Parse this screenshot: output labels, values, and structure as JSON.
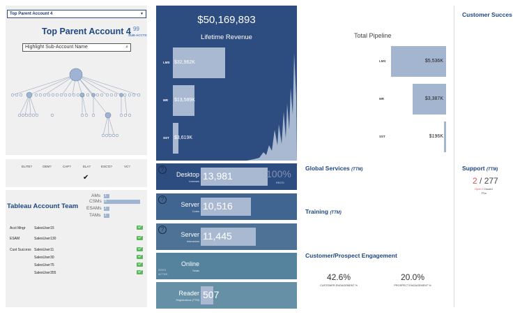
{
  "account": {
    "selector_value": "Top Parent Account 4",
    "title": "Top Parent Account 4",
    "subaccts_count": "99",
    "subaccts_label": "SUB-ACCTS",
    "search_placeholder": "Highlight Sub-Account Name"
  },
  "flags": {
    "labels": [
      "ELITE?",
      "OEM?",
      "CAP?",
      "ELA?",
      "ESC'D?",
      "VC?"
    ],
    "checked_index": 3,
    "check_glyph": "✔"
  },
  "team": {
    "title": "Tableau Account Team",
    "role_counts": [
      {
        "label": "AMs",
        "count": "1",
        "fraction": 0.12
      },
      {
        "label": "CSMs",
        "count": "6",
        "fraction": 1.0
      },
      {
        "label": "ESAMs",
        "count": "1",
        "fraction": 0.12
      },
      {
        "label": "TAMs",
        "count": "1",
        "fraction": 0.12
      }
    ],
    "members": [
      {
        "role": "Acct Mngr",
        "user": "SalesUser15"
      },
      {
        "role": "ESAM",
        "user": "SalesUser130"
      },
      {
        "role": "Cust Success",
        "user": "SalesUser11"
      },
      {
        "role": "",
        "user": "SalesUser30"
      },
      {
        "role": "",
        "user": "SalesUser75"
      },
      {
        "role": "",
        "user": "SalesUser355"
      }
    ]
  },
  "revenue": {
    "value": "$50,169,893",
    "label": "Lifetime Revenue",
    "bars": [
      {
        "cat": "LMS",
        "value": 32962,
        "text": "$32,962K"
      },
      {
        "cat": "MR",
        "value": 13589,
        "text": "$13,589K"
      },
      {
        "cat": "SST",
        "value": 3619,
        "text": "$3,619K"
      }
    ]
  },
  "kpis": [
    {
      "name": "Desktop",
      "sub": "Licenses",
      "value": "13,981",
      "fraction": 1.0,
      "extra": "100%",
      "extra_sub": "REG'D",
      "bg": "#2d4c7f"
    },
    {
      "name": "Server",
      "sub": "Cores",
      "value": "10,516",
      "fraction": 0.75,
      "extra": "",
      "extra_sub": "",
      "bg": "#3f6590"
    },
    {
      "name": "Server",
      "sub": "Interactors",
      "value": "11,445",
      "fraction": 0.82,
      "extra": "",
      "extra_sub": "",
      "bg": "#4d7296"
    },
    {
      "name": "Online",
      "sub": "Seats",
      "value": "",
      "fraction": 0,
      "extra": "",
      "extra_sub": "",
      "bg": "#55829d",
      "side": "SITES\nACTIVE"
    },
    {
      "name": "Reader",
      "sub": "Registrations (TTM)",
      "value": "507",
      "fraction": 0.12,
      "extra": "",
      "extra_sub": "",
      "bg": "#6690a5"
    }
  ],
  "pipeline": {
    "title": "Total Pipeline",
    "bars": [
      {
        "cat": "LMS",
        "value": 5536,
        "text": "$5,536K"
      },
      {
        "cat": "MR",
        "value": 3387,
        "text": "$3,387K"
      },
      {
        "cat": "SST",
        "value": 196,
        "text": "$196K"
      }
    ]
  },
  "sections": {
    "global_services": "Global Services",
    "global_services_suffix": "(TTM)",
    "training": "Training",
    "training_suffix": "(TTM)",
    "engagement": "Customer/Prospect Engagement",
    "customer_success": "Customer Succes",
    "support": "Support",
    "support_suffix": "(TTM)"
  },
  "engagement": {
    "customer_pct": "42.6%",
    "customer_label": "CUSTOMER ENGAGEMENT %",
    "prospect_pct": "20.0%",
    "prospect_label": "PROSPECT ENGAGEMENT %"
  },
  "support": {
    "open": "2",
    "sep": " / ",
    "closed": "277",
    "open_label": "Open",
    "closed_label": " / Closed",
    "p1s": "P1s",
    "open_color": "#e05252"
  }
}
